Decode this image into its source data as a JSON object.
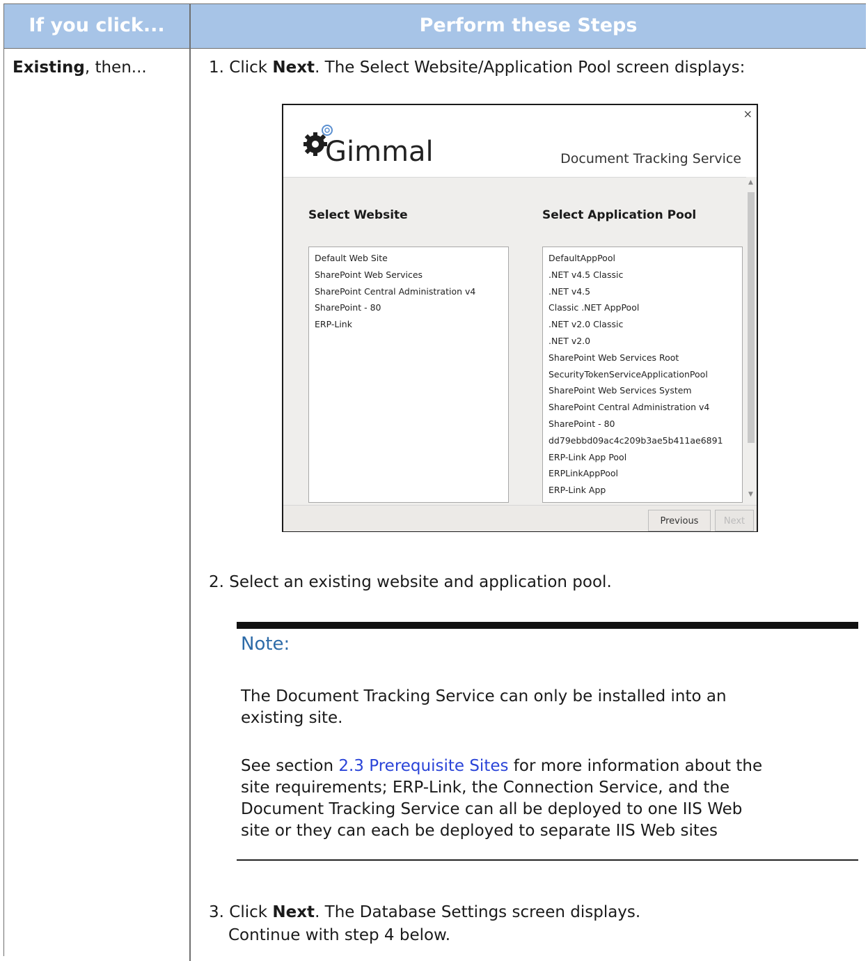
{
  "table": {
    "header_col1": "If you click...",
    "header_col2": "Perform these Steps",
    "row_label_bold": "Existing",
    "row_label_rest": ", then..."
  },
  "steps": {
    "step1_prefix": "1. Click ",
    "step1_bold": "Next",
    "step1_suffix": ". The Select Website/Application Pool screen displays:",
    "step2": "2. Select an existing website and application pool.",
    "step3_prefix": "3. Click ",
    "step3_bold": "Next",
    "step3_suffix": ". The Database Settings screen displays.",
    "step3_line2": "Continue with step 4 below."
  },
  "dialog": {
    "close": "×",
    "logo_text": "Gimmal",
    "service_name": "Document Tracking Service",
    "website_label": "Select Website",
    "apppool_label": "Select Application Pool",
    "websites": [
      "Default Web Site",
      "SharePoint Web Services",
      "SharePoint Central Administration v4",
      "SharePoint - 80",
      "ERP-Link"
    ],
    "app_pools": [
      "DefaultAppPool",
      ".NET v4.5 Classic",
      ".NET v4.5",
      "Classic .NET AppPool",
      ".NET v2.0 Classic",
      ".NET v2.0",
      "SharePoint Web Services Root",
      "SecurityTokenServiceApplicationPool",
      "SharePoint Web Services System",
      "SharePoint Central Administration v4",
      "SharePoint - 80",
      "dd79ebbd09ac4c209b3ae5b411ae6891",
      "ERP-Link App Pool",
      "ERPLinkAppPool",
      "ERP-Link App"
    ],
    "previous_label": "Previous",
    "next_label": "Next"
  },
  "note": {
    "title": "Note:",
    "para1_line1": "The Document Tracking Service can only be installed into an",
    "para1_line2": "existing site.",
    "para2_prefix": "See section ",
    "para2_link": "2.3 Prerequisite Sites",
    "para2_line1_suffix": " for more information about the",
    "para2_line2": "site requirements; ERP-Link, the Connection Service, and the",
    "para2_line3": "Document Tracking Service can all be deployed to one IIS Web",
    "para2_line4": "site or they can each be deployed to separate IIS Web sites"
  },
  "colors": {
    "header_bg": "#a7c4e7",
    "note_title": "#2d6ba8",
    "link": "#2a44d8"
  }
}
